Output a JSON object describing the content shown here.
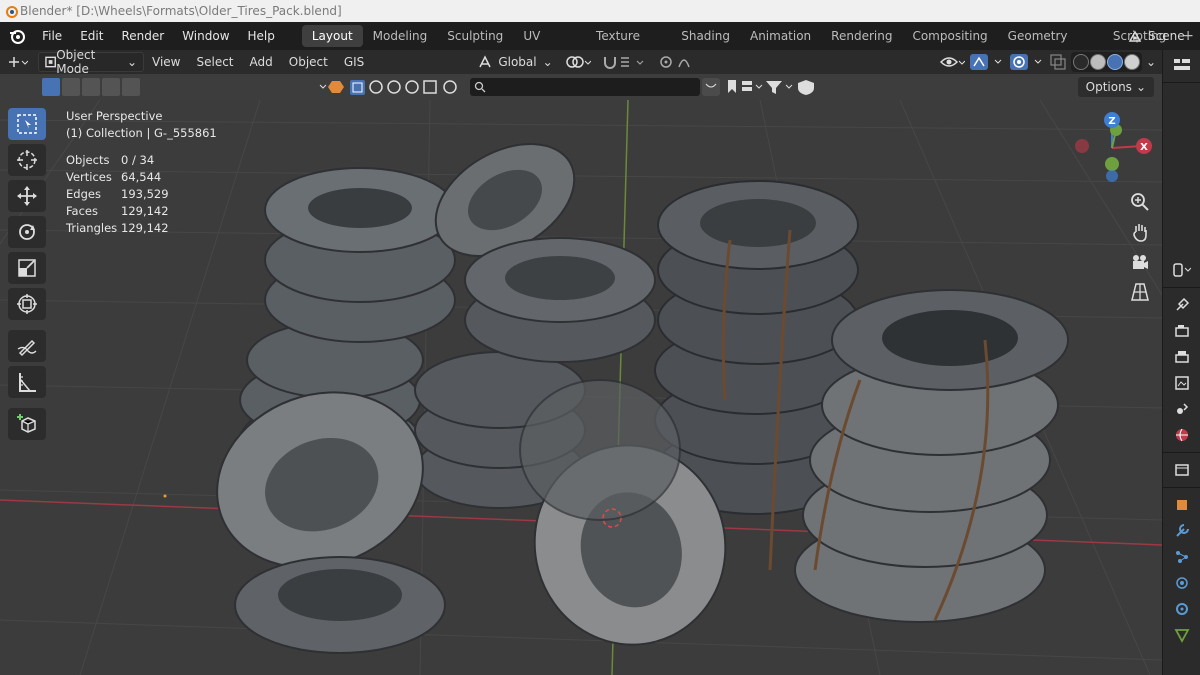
{
  "window": {
    "title": "Blender* [D:\\Wheels\\Formats\\Older_Tires_Pack.blend]"
  },
  "menu": {
    "items": [
      "File",
      "Edit",
      "Render",
      "Window",
      "Help"
    ]
  },
  "workspaces": {
    "tabs": [
      "Layout",
      "Modeling",
      "Sculpting",
      "UV Editing",
      "Texture Paint",
      "Shading",
      "Animation",
      "Rendering",
      "Compositing",
      "Geometry Nodes",
      "Scripting"
    ],
    "active": "Layout",
    "add_label": "+"
  },
  "scene": {
    "label": "Scene"
  },
  "header": {
    "mode": "Object Mode",
    "menus": [
      "View",
      "Select",
      "Add",
      "Object",
      "GIS"
    ],
    "orientation": "Global"
  },
  "toolbar2": {
    "options_label": "Options"
  },
  "viewport": {
    "perspective": "User Perspective",
    "collection": "(1) Collection | G-_555861",
    "stats": [
      {
        "label": "Objects",
        "value": "0 / 34"
      },
      {
        "label": "Vertices",
        "value": "64,544"
      },
      {
        "label": "Edges",
        "value": "193,529"
      },
      {
        "label": "Faces",
        "value": "129,142"
      },
      {
        "label": "Triangles",
        "value": "129,142"
      }
    ]
  },
  "gizmo": {
    "z": "Z",
    "x": "X"
  },
  "colors": {
    "accent": "#4772b3",
    "background": "#3c3c3c",
    "x_axis": "#c13a4a",
    "y_axis": "#6ea040",
    "z_axis": "#3d7fd4"
  }
}
